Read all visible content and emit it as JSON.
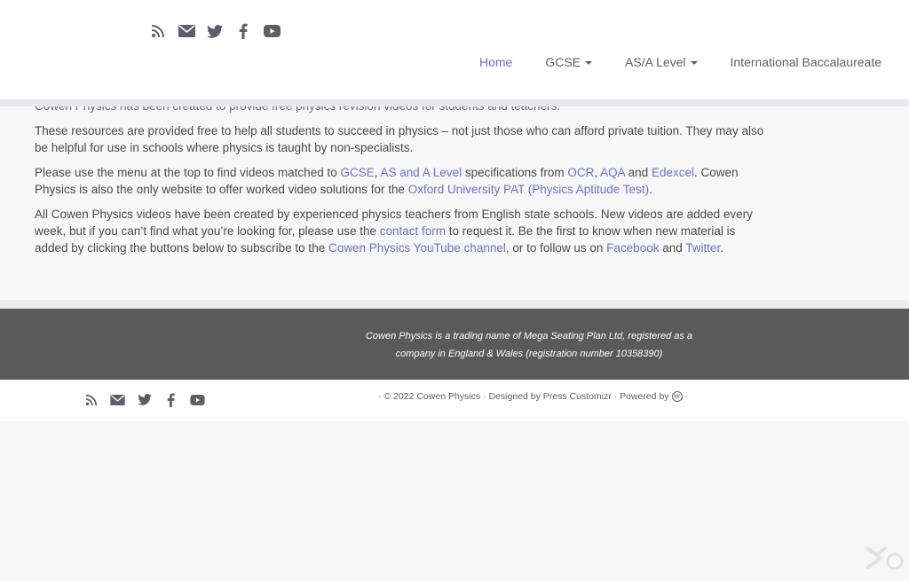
{
  "header": {
    "social_icons": [
      "rss-icon",
      "email-icon",
      "twitter-icon",
      "facebook-icon",
      "youtube-icon"
    ],
    "nav": [
      {
        "label": "Home",
        "active": true,
        "has_dropdown": false
      },
      {
        "label": "GCSE",
        "active": false,
        "has_dropdown": true
      },
      {
        "label": "AS/A Level",
        "active": false,
        "has_dropdown": true
      },
      {
        "label": "International Baccalaureate",
        "active": false,
        "has_dropdown": false
      }
    ]
  },
  "content": {
    "p0": "Cowen Physics has been created to provide free physics revision videos for students and teachers.",
    "p1": "These resources are provided free to help all students to succeed in physics – not just those who can afford private tuition. They may also be helpful for use in schools where physics is taught by non-specialists.",
    "p2": {
      "t1": "Please use the menu at the top to find videos matched to ",
      "link_gcse": "GCSE",
      "t2": ", ",
      "link_as": "AS and A Level",
      "t3": " specifications from ",
      "link_ocr": "OCR",
      "t4": ", ",
      "link_aqa": "AQA",
      "t5": " and ",
      "link_edexcel": "Edexcel",
      "t6": ". Cowen Physics is also the only website to offer worked video solutions for the ",
      "link_pat": "Oxford University PAT (Physics Aptitude Test)",
      "t7": "."
    },
    "p3": {
      "t1": "All Cowen Physics videos have been created by experienced physics teachers from English state schools. New videos are added every week, but if you can’t find what you’re looking for, please use the ",
      "link_contact": "contact form",
      "t2": " to request it. Be the first to know when new material is added by clicking the buttons below to subscribe to the ",
      "link_youtube": "Cowen Physics YouTube channel",
      "t3": ", or to follow us on ",
      "link_facebook": "Facebook",
      "t4": " and ",
      "link_twitter": "Twitter",
      "t5": "."
    }
  },
  "footer": {
    "legal_line1": "Cowen Physics is a trading name of Mega Seating Plan Ltd, registered as a",
    "legal_line2": "company in England & Wales (registration number 10358390)",
    "credits": "· © 2022 Cowen Physics · Designed by Press Customizr · Powered by",
    "credits_end": "·",
    "social_icons": [
      "rss-icon",
      "email-icon",
      "twitter-icon",
      "facebook-icon",
      "youtube-icon"
    ]
  },
  "colors": {
    "link": "#6872c9",
    "text": "#4a4a4a",
    "footer_dark": "#5a5a5a"
  }
}
